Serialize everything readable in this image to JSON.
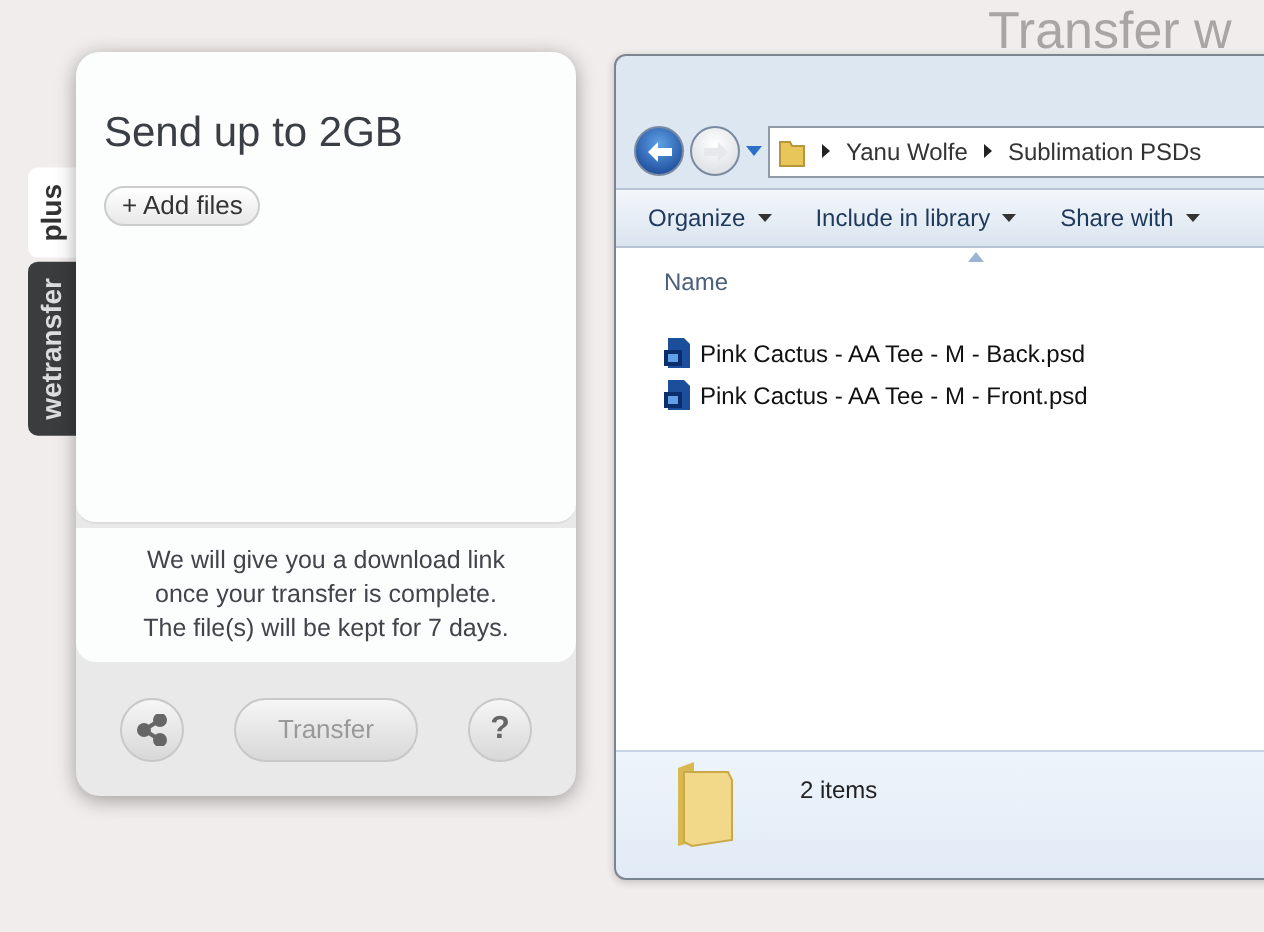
{
  "heading": "Transfer w",
  "widget": {
    "side_tabs": [
      {
        "label": "plus",
        "selected": true
      },
      {
        "label": "wetransfer",
        "selected": false
      }
    ],
    "title": "Send up to 2GB",
    "add_button": "+ Add files",
    "info": "We will give you a download link\nonce your transfer is complete.\nThe file(s) will be kept for 7 days.",
    "transfer_button": {
      "label": "Transfer",
      "disabled": true
    },
    "help_button": "?"
  },
  "explorer": {
    "breadcrumb": [
      "Yanu Wolfe",
      "Sublimation PSDs"
    ],
    "toolbar": [
      "Organize",
      "Include in library",
      "Share with"
    ],
    "column": "Name",
    "files": [
      "Pink Cactus - AA Tee - M - Back.psd",
      "Pink Cactus - AA Tee - M - Front.psd"
    ],
    "status": "2 items"
  }
}
